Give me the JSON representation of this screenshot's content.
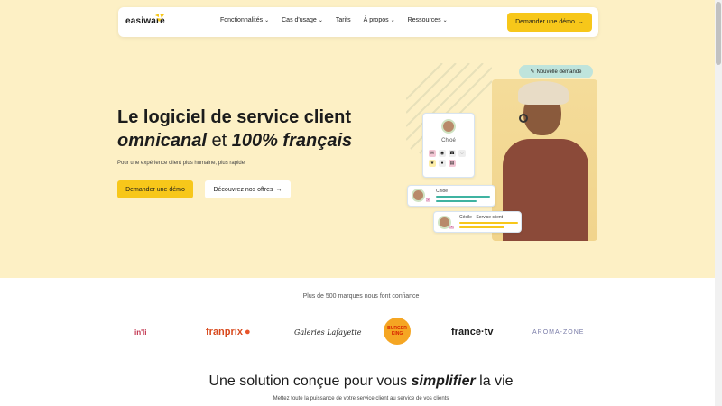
{
  "header": {
    "logo_text": "easiware",
    "nav": [
      {
        "label": "Fonctionnalités",
        "has_dropdown": true
      },
      {
        "label": "Cas d'usage",
        "has_dropdown": true
      },
      {
        "label": "Tarifs",
        "has_dropdown": false
      },
      {
        "label": "À propos",
        "has_dropdown": true
      },
      {
        "label": "Ressources",
        "has_dropdown": true
      }
    ],
    "cta_label": "Demander une démo"
  },
  "hero": {
    "headline_line1": "Le logiciel de service client",
    "headline_em1": "omnicanal",
    "headline_mid": " et ",
    "headline_em2": "100% français",
    "subline": "Pour une expérience client plus humaine, plus rapide",
    "btn_demo": "Demander une démo",
    "btn_offers": "Découvrez nos offres",
    "badge_new": "Nouvelle demande",
    "profile_name": "Chloé",
    "chat1_label": "Chloé",
    "chat2_label": "Cécile · Service client"
  },
  "trust": {
    "text": "Plus de 500 marques nous font confiance",
    "brands": {
      "inli": "in'li",
      "franprix": "franprix",
      "galeries": "Galeries Lafayette",
      "bk_line1": "BURGER",
      "bk_line2": "KING",
      "francetv": "france·tv",
      "aroma": "AROMA-ZONE"
    }
  },
  "section": {
    "title_pre": "Une solution conçue pour vous ",
    "title_em": "simplifier",
    "title_post": " la vie",
    "subtitle": "Mettez toute la puissance de votre service client au service de vos clients"
  },
  "colors": {
    "hero_bg": "#fdf0c5",
    "accent_yellow": "#f7c71a",
    "badge_mint": "#bfe4dc"
  }
}
